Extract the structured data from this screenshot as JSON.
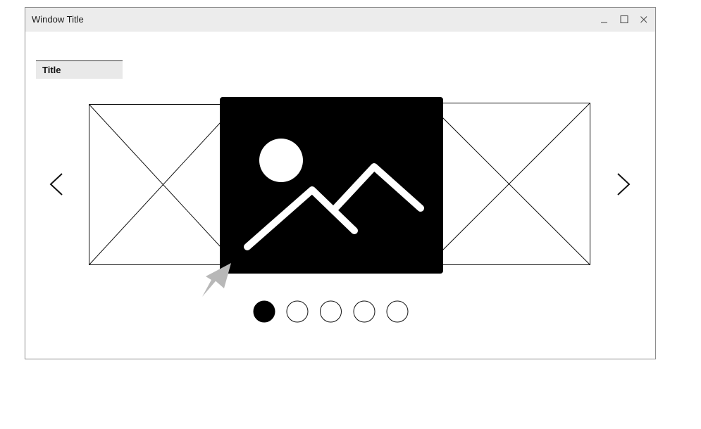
{
  "window": {
    "title": "Window Title",
    "controls": [
      "minimize",
      "maximize",
      "close"
    ]
  },
  "section": {
    "title": "Title"
  },
  "carousel": {
    "slide_count": 5,
    "active_index": 0,
    "center_slide_icon": "image-icon",
    "side_slide_icon": "image-placeholder-x",
    "prev_icon": "chevron-left-icon",
    "next_icon": "chevron-right-icon"
  },
  "colors": {
    "titlebar": "#ececec",
    "active_slide": "#000000",
    "dot_active": "#000000",
    "cursor": "#b8b8b8"
  }
}
